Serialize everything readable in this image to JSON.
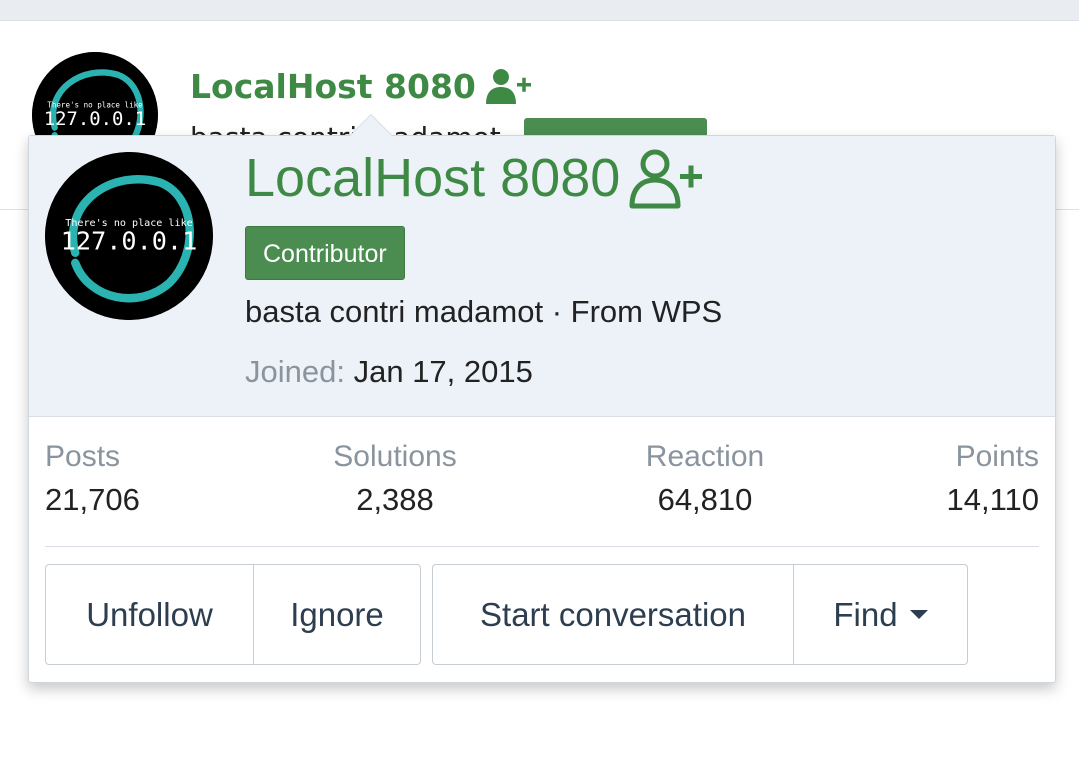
{
  "background": {
    "name": "LocalHost 8080",
    "subtitle_partial": "basta contri madamot"
  },
  "avatar": {
    "small_text": "There's no place like",
    "big_text": "127.0.0.1"
  },
  "card": {
    "name": "LocalHost 8080",
    "badge": "Contributor",
    "subtitle": "basta contri madamot · From WPS",
    "joined_label": "Joined:",
    "joined_value": "Jan 17, 2015"
  },
  "stats": [
    {
      "label": "Posts",
      "value": "21,706"
    },
    {
      "label": "Solutions",
      "value": "2,388"
    },
    {
      "label": "Reaction",
      "value": "64,810"
    },
    {
      "label": "Points",
      "value": "14,110"
    }
  ],
  "actions": {
    "unfollow": "Unfollow",
    "ignore": "Ignore",
    "start_conversation": "Start conversation",
    "find": "Find"
  },
  "colors": {
    "accent_green": "#3e8a45",
    "badge_green": "#4b8d50",
    "header_bg": "#ecf2f8",
    "muted_text": "#8a949e",
    "avatar_ring": "#2ab3b0"
  },
  "icons": [
    "add-user-icon",
    "caret-down-icon"
  ]
}
